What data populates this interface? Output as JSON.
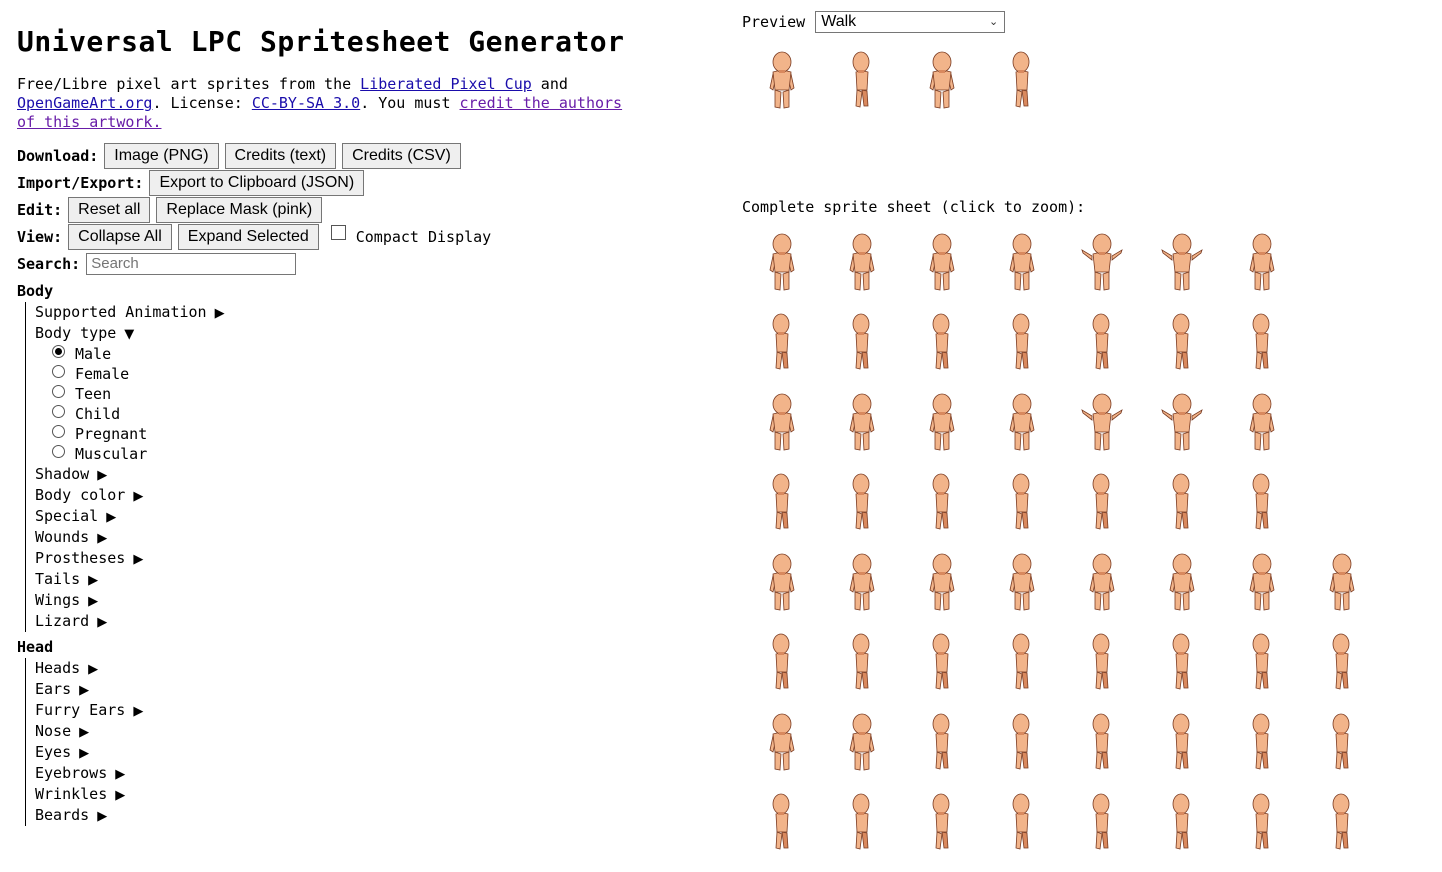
{
  "title": "Universal LPC Spritesheet Generator",
  "intro": {
    "t1": "Free/Libre pixel art sprites from the ",
    "link1": "Liberated Pixel Cup",
    "t2": " and ",
    "link2": "OpenGameArt.org",
    "t3": ". License: ",
    "link3": "CC-BY-SA 3.0",
    "t4": ". You must ",
    "link4": "credit the authors of this artwork."
  },
  "download": {
    "label": "Download:",
    "buttons": [
      "Image (PNG)",
      "Credits (text)",
      "Credits (CSV)"
    ]
  },
  "import_export": {
    "label": "Import/Export:",
    "button": "Export to Clipboard (JSON)"
  },
  "edit": {
    "label": "Edit:",
    "buttons": [
      "Reset all",
      "Replace Mask (pink)"
    ]
  },
  "view": {
    "label": "View:",
    "buttons": [
      "Collapse All",
      "Expand Selected"
    ],
    "compact_label": "Compact Display",
    "compact_checked": false
  },
  "search": {
    "label": "Search:",
    "placeholder": "Search"
  },
  "tree": {
    "body": {
      "title": "Body",
      "supported_animation": "Supported Animation",
      "body_type": "Body type",
      "body_types": [
        "Male",
        "Female",
        "Teen",
        "Child",
        "Pregnant",
        "Muscular"
      ],
      "selected_body_type": "Male",
      "items": [
        "Shadow",
        "Body color",
        "Special",
        "Wounds",
        "Prostheses",
        "Tails",
        "Wings",
        "Lizard"
      ]
    },
    "head": {
      "title": "Head",
      "items": [
        "Heads",
        "Ears",
        "Furry Ears",
        "Nose",
        "Eyes",
        "Eyebrows",
        "Wrinkles",
        "Beards"
      ]
    },
    "collapsed_glyph": "▶",
    "expanded_glyph": "▼"
  },
  "preview": {
    "label": "Preview",
    "selected": "Walk"
  },
  "sheet_label": "Complete sprite sheet (click to zoom):",
  "colors": {
    "skin": "#f2b48a",
    "skin_shade": "#d9895e",
    "outline": "#7a3b22",
    "link": "#1a0dab",
    "visited": "#681da8"
  }
}
